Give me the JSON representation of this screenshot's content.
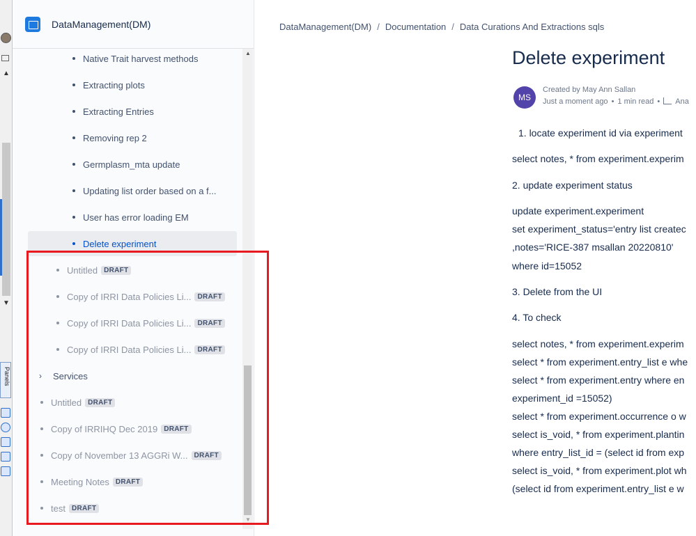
{
  "space": {
    "name": "DataManagement(DM)"
  },
  "tree": {
    "children": [
      {
        "label": "Native Trait harvest methods"
      },
      {
        "label": "Extracting plots"
      },
      {
        "label": "Extracting Entries"
      },
      {
        "label": "Removing rep 2"
      },
      {
        "label": "Germplasm_mta update"
      },
      {
        "label": "Updating list order based on a f..."
      },
      {
        "label": "User has error loading EM"
      },
      {
        "label": "Delete experiment"
      }
    ],
    "siblings": [
      {
        "label": "Untitled",
        "badge": "DRAFT"
      },
      {
        "label": "Copy of IRRI Data Policies Li...",
        "badge": "DRAFT"
      },
      {
        "label": "Copy of IRRI Data Policies Li...",
        "badge": "DRAFT"
      },
      {
        "label": "Copy of IRRI Data Policies Li...",
        "badge": "DRAFT"
      }
    ],
    "top": [
      {
        "label": "Services"
      },
      {
        "label": "Untitled",
        "badge": "DRAFT"
      },
      {
        "label": "Copy of IRRIHQ Dec 2019",
        "badge": "DRAFT"
      },
      {
        "label": "Copy of November 13 AGGRi W...",
        "badge": "DRAFT"
      },
      {
        "label": "Meeting Notes",
        "badge": "DRAFT"
      },
      {
        "label": "test",
        "badge": "DRAFT"
      }
    ]
  },
  "strip": {
    "panels_label": "Panels"
  },
  "breadcrumb": [
    "DataManagement(DM)",
    "Documentation",
    "Data Curations And Extractions sqls"
  ],
  "page": {
    "title": "Delete experiment",
    "author_initials": "MS",
    "created_by": "Created by May Ann Sallan",
    "time": "Just a moment ago",
    "read_time": "1 min read",
    "analytics": "Ana",
    "lines": [
      "1. locate experiment id via experiment",
      "select notes, * from experiment.experim",
      "2. update experiment status",
      "update  experiment.experiment",
      "set experiment_status='entry list createc",
      ",notes='RICE-387 msallan 20220810'",
      "where id=15052",
      "3. Delete from the UI",
      "4. To check",
      "select notes, * from experiment.experim",
      "select * from experiment.entry_list e whe",
      "select * from experiment.entry where en",
      "experiment_id =15052)",
      "select * from experiment.occurrence o w",
      "select is_void, * from experiment.plantin",
      "where entry_list_id = (select id  from exp",
      "select is_void, * from experiment.plot wh",
      "(select id  from experiment.entry_list e w"
    ]
  }
}
